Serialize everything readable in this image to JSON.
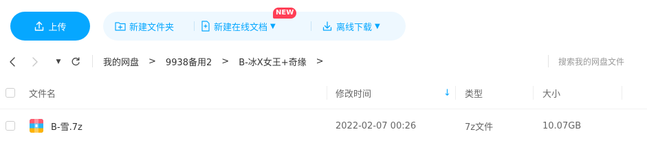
{
  "toolbar": {
    "upload_label": "上传",
    "new_folder_label": "新建文件夹",
    "new_doc_label": "新建在线文档",
    "new_badge": "NEW",
    "offline_download_label": "离线下载"
  },
  "nav": {
    "back_icon": "chevron-left-icon",
    "forward_icon": "chevron-right-icon",
    "dropdown_icon": "caret-down-icon",
    "refresh_icon": "refresh-icon",
    "breadcrumbs": [
      "我的网盘",
      "9938备用2",
      "B-冰X女王+奇缘"
    ],
    "separator": ">"
  },
  "search": {
    "placeholder": "搜索我的网盘文件"
  },
  "table": {
    "columns": {
      "name": "文件名",
      "mtime": "修改时间",
      "sort_indicator": "↓",
      "type": "类型",
      "size": "大小"
    },
    "rows": [
      {
        "icon": "zip-archive-icon",
        "name": "B-雪.7z",
        "mtime": "2022-02-07 00:26",
        "type": "7z文件",
        "size": "10.07GB"
      }
    ]
  },
  "colors": {
    "accent": "#06a7ff",
    "accent_light_bg": "#eef8ff",
    "badge": "#ff3e55"
  }
}
